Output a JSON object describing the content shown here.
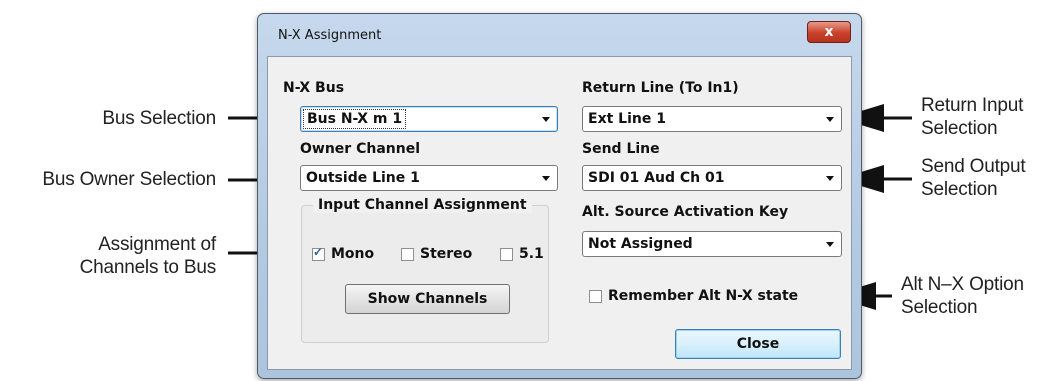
{
  "window": {
    "title": "N-X Assignment",
    "close_glyph": "x"
  },
  "left": {
    "bus_label": "N-X Bus",
    "bus_value": "Bus N-X m  1",
    "owner_label": "Owner Channel",
    "owner_value": "Outside Line 1",
    "group_title": "Input Channel Assignment",
    "mono_label": "Mono",
    "mono_checked": true,
    "stereo_label": "Stereo",
    "stereo_checked": false,
    "surround_label": "5.1",
    "surround_checked": false,
    "show_channels_label": "Show Channels"
  },
  "right": {
    "return_label": "Return Line (To In1)",
    "return_value": "Ext Line 1",
    "send_label": "Send Line",
    "send_value": "SDI 01 Aud Ch 01",
    "alt_key_label": "Alt. Source Activation Key",
    "alt_key_value": "Not Assigned",
    "remember_label": "Remember Alt N-X state",
    "remember_checked": false,
    "close_label": "Close"
  },
  "callouts": {
    "bus_selection": "Bus Selection",
    "bus_owner_selection": "Bus Owner Selection",
    "assignment_line1": "Assignment of",
    "assignment_line2": "Channels to Bus",
    "return_line1": "Return Input",
    "return_line2": "Selection",
    "send_line1": "Send Output",
    "send_line2": "Selection",
    "alt_line1": "Alt N–X Option",
    "alt_line2": "Selection"
  },
  "colors": {
    "window_frame": "#b3cae3",
    "client_bg": "#f0f0f0",
    "close_button": "#c9412a",
    "arrow": "#111111"
  }
}
